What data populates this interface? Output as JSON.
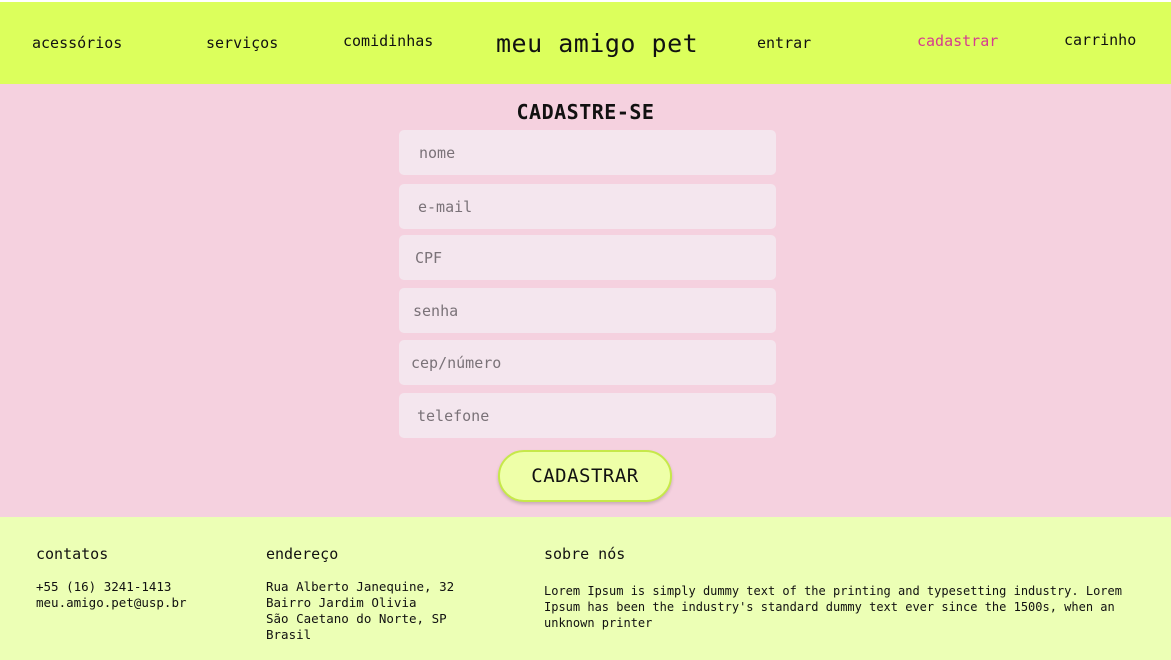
{
  "header": {
    "logo": "meu amigo pet",
    "nav": {
      "acessorios": "acessórios",
      "servicos": "serviços",
      "comidinhas": "comidinhas",
      "entrar": "entrar",
      "cadastrar": "cadastrar",
      "carrinho": "carrinho"
    },
    "active_nav": "cadastrar",
    "colors": {
      "background": "#dcff5c",
      "active": "#d63c8f"
    }
  },
  "form": {
    "title": "CADASTRE-SE",
    "fields": {
      "nome": {
        "placeholder": "nome",
        "value": ""
      },
      "email": {
        "placeholder": "e-mail",
        "value": ""
      },
      "cpf": {
        "placeholder": "CPF",
        "value": ""
      },
      "senha": {
        "placeholder": "senha",
        "value": ""
      },
      "cep": {
        "placeholder": "cep/número",
        "value": ""
      },
      "telefone": {
        "placeholder": "telefone",
        "value": ""
      }
    },
    "submit_label": "CADASTRAR",
    "colors": {
      "background": "#f5d1df",
      "field": "#f4e6ee",
      "button": "#eeffa8"
    }
  },
  "footer": {
    "contatos": {
      "heading": "contatos",
      "phone": "+55 (16) 3241-1413",
      "email": "meu.amigo.pet@usp.br"
    },
    "endereco": {
      "heading": "endereço",
      "line1": "Rua Alberto Janequine, 32",
      "line2": "Bairro Jardim Olivia",
      "line3": "São Caetano do Norte, SP",
      "line4": "Brasil"
    },
    "sobre": {
      "heading": "sobre nós",
      "text": "Lorem Ipsum is simply dummy text of the printing and typesetting industry. Lorem Ipsum has been the industry's standard dummy text ever since the 1500s, when an unknown printer"
    },
    "colors": {
      "background": "#ecffb5"
    }
  }
}
